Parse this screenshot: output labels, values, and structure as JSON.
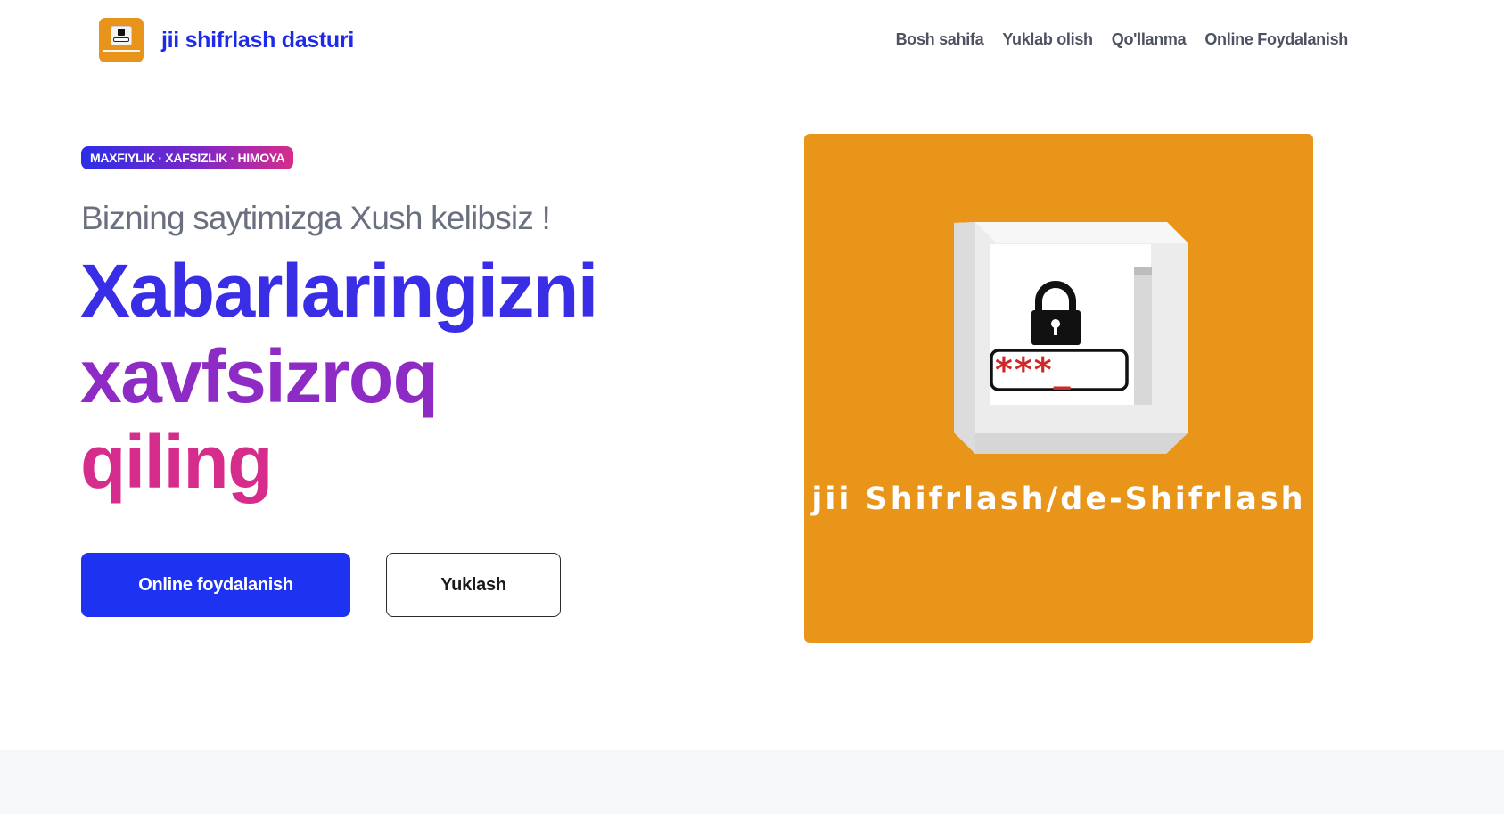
{
  "header": {
    "brand_name": "jii shifrlash dasturi",
    "logo_icon": "lock-logo-icon",
    "nav": [
      {
        "label": "Bosh sahifa"
      },
      {
        "label": "Yuklab olish"
      },
      {
        "label": "Qo'llanma"
      },
      {
        "label": "Online Foydalanish"
      }
    ]
  },
  "hero": {
    "badge": "MAXFIYLIK · XAFSIZLIK · HIMOYA",
    "welcome": "Bizning saytimizga Xush kelibsiz !",
    "headline": [
      "Xabarlaringizni",
      "xavfsizroq",
      "qiling"
    ],
    "primary_button": "Online foydalanish",
    "secondary_button": "Yuklash",
    "image_caption": "jii Shifrlash/de-Shifrlash",
    "password_mask": "***_"
  },
  "colors": {
    "brand_blue": "#1f2ae8",
    "primary_button": "#1e32f2",
    "image_orange": "#e9951a",
    "gradient_start": "#3a2de6",
    "gradient_mid": "#8d2bc4",
    "gradient_end": "#d62c8c"
  }
}
